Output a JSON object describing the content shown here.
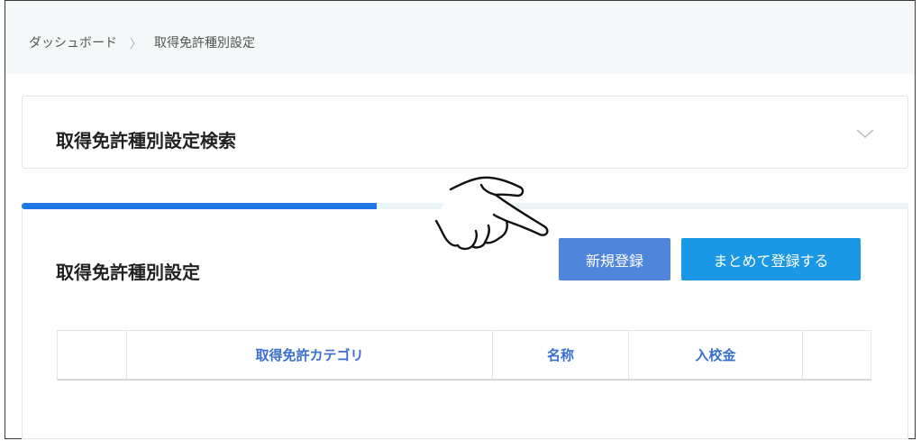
{
  "breadcrumb": {
    "home": "ダッシュボード",
    "separator": "〉",
    "current": "取得免許種別設定"
  },
  "search_panel": {
    "title": "取得免許種別設定検索",
    "toggle_icon": "chevron-down-icon"
  },
  "progress": {
    "fraction": 0.4
  },
  "main": {
    "title": "取得免許種別設定",
    "new_button": "新規登録",
    "bulk_button": "まとめて登録する"
  },
  "table": {
    "columns": [
      "",
      "取得免許カテゴリ",
      "名称",
      "入校金",
      ""
    ]
  },
  "colors": {
    "progress": "#1f78e6",
    "new_button": "#4f86db",
    "bulk_button": "#1a98e6",
    "header_text": "#3a6fcf"
  },
  "overlay_icon": "pointing-hand-icon"
}
